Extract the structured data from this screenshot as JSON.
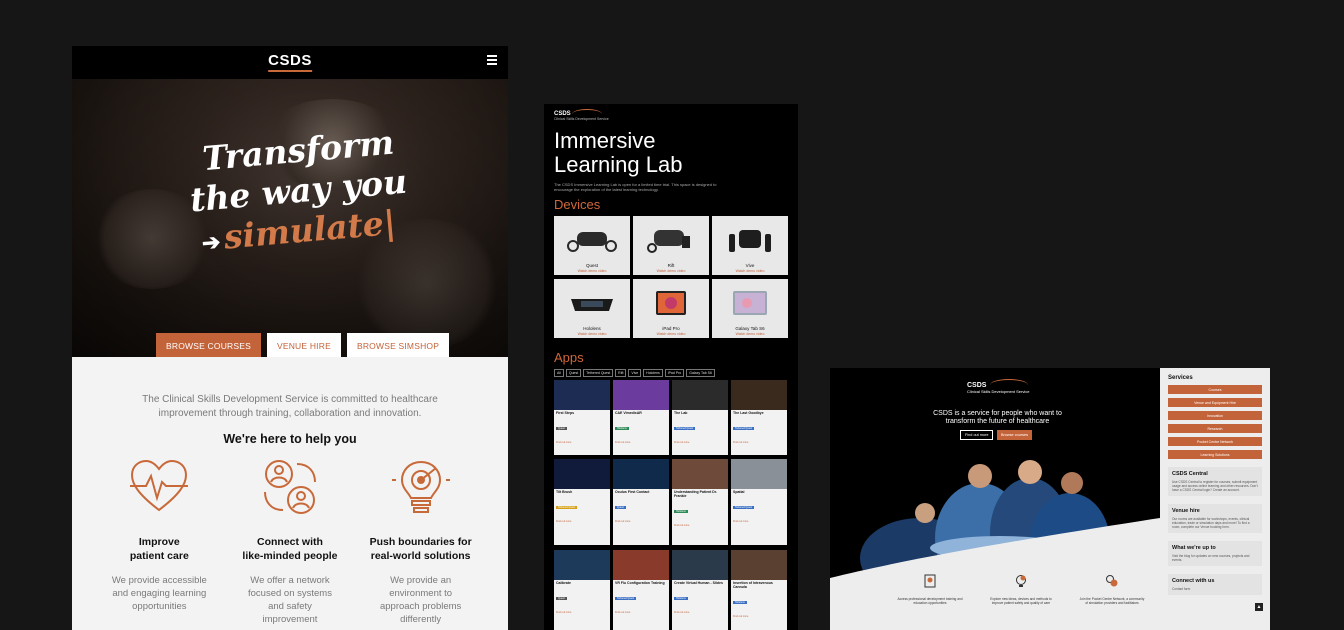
{
  "panel1": {
    "logo": "CSDS",
    "headline": {
      "line1": "Transform",
      "line2": "the way you",
      "line3": "simulate|"
    },
    "buttons": {
      "courses": "BROWSE COURSES",
      "venue": "VENUE HIRE",
      "simshop": "BROWSE SIMSHOP"
    },
    "intro": "The Clinical Skills Development Service is committed to healthcare improvement through training, collaboration and innovation.",
    "help_heading": "We're here to help you",
    "features": [
      {
        "title": "Improve\npatient care",
        "desc": "We provide accessible\nand engaging learning\nopportunities"
      },
      {
        "title": "Connect with\nlike-minded people",
        "desc": "We offer a network\nfocused on systems\nand safety\nimprovement"
      },
      {
        "title": "Push boundaries for\nreal-world solutions",
        "desc": "We provide an\nenvironment to\napproach problems\ndifferently"
      }
    ]
  },
  "panel2": {
    "logo": "CSDS",
    "logo_sub": "Clinical Skills Development Service",
    "title1": "Immersive",
    "title2": "Learning Lab",
    "subtitle": "The CSDS Immersive Learning Lab is open for a limited time trial. This space is designed to encourage the exploration of the latest learning technology.",
    "devices_heading": "Devices",
    "devices": [
      {
        "name": "Quest",
        "link": "Watch demo video"
      },
      {
        "name": "Rift",
        "link": "Watch demo video"
      },
      {
        "name": "Vive",
        "link": "Watch demo video"
      },
      {
        "name": "Hololens",
        "link": "Watch demo video"
      },
      {
        "name": "iPad Pro",
        "link": "Watch demo video"
      },
      {
        "name": "Galaxy Tab S6",
        "link": "Watch demo video"
      }
    ],
    "apps_heading": "Apps",
    "filters": [
      "All",
      "Quest",
      "Tethered Quest",
      "Rift",
      "Vive",
      "Hololens",
      "iPad Pro",
      "Galaxy Tab S6"
    ],
    "apps": [
      {
        "title": "First Steps",
        "tag": "Quest",
        "tag_color": "#555555",
        "color": "#1c2c52"
      },
      {
        "title": "CAE VimedixAR",
        "tag": "Hololens",
        "tag_color": "#2e8b57",
        "color": "#6b3b9e"
      },
      {
        "title": "The Lab",
        "tag": "Tethered Quest",
        "tag_color": "#3a6fc4",
        "color": "#2b2b2b"
      },
      {
        "title": "The Last Goodbye",
        "tag": "Tethered Quest",
        "tag_color": "#3a6fc4",
        "color": "#3a2a1e"
      },
      {
        "title": "Tilt Brush",
        "tag": "Tethered Quest",
        "tag_color": "#d4a017",
        "color": "#101a3a"
      },
      {
        "title": "Oculus First Contact",
        "tag": "Quest",
        "tag_color": "#3a6fc4",
        "color": "#0f2a4a"
      },
      {
        "title": "Understanding Patient Dr. Frankie",
        "tag": "Hololens",
        "tag_color": "#2e8b57",
        "color": "#6e4a3a"
      },
      {
        "title": "Spatial",
        "tag": "Tethered Quest",
        "tag_color": "#3a6fc4",
        "color": "#8a9098"
      },
      {
        "title": "Calibrate",
        "tag": "Quest",
        "tag_color": "#555555",
        "color": "#1e3a5a"
      },
      {
        "title": "VR Flu Configuration Training",
        "tag": "Tethered Quest",
        "tag_color": "#3a6fc4",
        "color": "#8a3a2a"
      },
      {
        "title": "Create Virtual Human - Slides",
        "tag": "Hololens",
        "tag_color": "#3a6fc4",
        "color": "#2a3a4a"
      },
      {
        "title": "Insertion of Intravenous Cannula",
        "tag": "Hololens",
        "tag_color": "#3a6fc4",
        "color": "#5a4030"
      }
    ],
    "more_link": "Find out more",
    "coming_link": "Coming soon"
  },
  "panel3": {
    "logo": "CSDS",
    "logo_sub": "Clinical Skills Development Service",
    "headline": "CSDS is a service for people who want to transform the future of healthcare",
    "btn_more": "Find out more",
    "btn_courses": "Browse courses",
    "icons": [
      {
        "desc": "Access professional development training and education opportunities"
      },
      {
        "desc": "Explore new ideas, devices and methods to improve patient safety and quality of care"
      },
      {
        "desc": "Join the Pocket Centre Network, a community of simulation providers and facilitators"
      }
    ],
    "services_heading": "Services",
    "services": [
      "Courses",
      "Venue and Equipment Hire",
      "Innovation",
      "Research",
      "Pocket Centre Network",
      "Learning Solutions"
    ],
    "boxes": [
      {
        "title": "CSDS Central",
        "text": "Use CSDS Central to register for courses, submit equipment usage and access online learning and other resources. Don't have a CSDS Central login? Create an account."
      },
      {
        "title": "Venue hire",
        "text": "Our rooms are available for workshops, events, clinical education, trade or simulation days and more! To find a room, complete our Venue booking form."
      },
      {
        "title": "What we're up to",
        "text": "Visit the blog for updates on new courses, projects and events."
      },
      {
        "title": "Connect with us",
        "text": "Contact form"
      }
    ],
    "up_arrow": "▲"
  }
}
